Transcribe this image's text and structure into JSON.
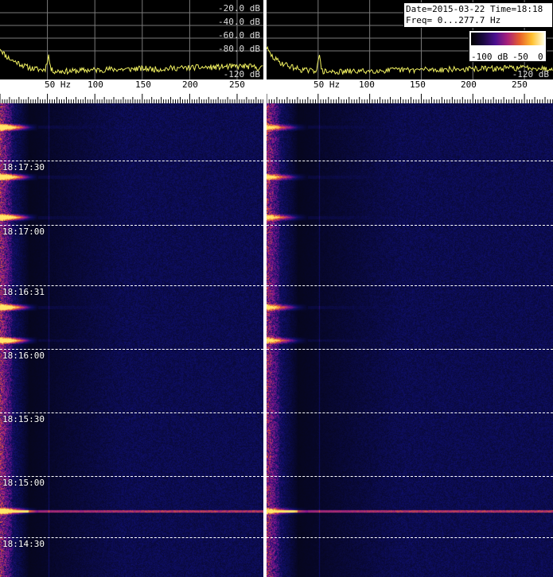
{
  "info_box": {
    "date_line": "Date=2015-03-22 Time=18:18",
    "freq_line": "Freq= 0...277.7 Hz"
  },
  "colorbar": {
    "ticks": [
      "-100 dB",
      "-50",
      "0"
    ],
    "stops": [
      "#000000",
      "#1a0840",
      "#4a0f8f",
      "#a8207a",
      "#e8602a",
      "#ffc030",
      "#ffffe0"
    ]
  },
  "colors": {
    "spectrum_line": "#f0f060",
    "grid": "#7a7a7a",
    "scale_bg": "#ffffff",
    "waterfall_bg": "#0a0c3a"
  },
  "chart_data": [
    {
      "type": "line",
      "name": "spectrum-left",
      "title": "",
      "xlabel": "Hz",
      "ylabel": "",
      "xlim": [
        0,
        277.7
      ],
      "ylim": [
        -125,
        0
      ],
      "y_ticks": [
        -20,
        -40,
        -60,
        -80,
        -120
      ],
      "y_tick_labels": [
        "-20.0 dB",
        "-40.0 dB",
        "-60.0 dB",
        "-80.0 dB",
        "-120 dB"
      ],
      "x_ticks": [
        50,
        100,
        150,
        200,
        250
      ],
      "x_tick_labels": [
        "50 Hz",
        "100",
        "150",
        "200",
        "250"
      ],
      "grid": true,
      "series": [
        {
          "x": [
            0,
            3,
            6,
            10,
            14,
            18,
            22,
            26,
            30,
            35,
            40,
            45,
            48,
            50,
            51,
            52,
            54,
            58,
            65,
            75,
            85,
            95,
            105,
            115,
            125,
            135,
            145,
            155,
            165,
            175,
            185,
            195,
            205,
            215,
            225,
            235,
            245,
            255,
            265,
            275
          ],
          "values": [
            -75,
            -82,
            -88,
            -92,
            -96,
            -98,
            -101,
            -104,
            -106,
            -108,
            -109,
            -110,
            -108,
            -94,
            -84,
            -96,
            -110,
            -112,
            -112,
            -112,
            -111,
            -110,
            -110,
            -109,
            -109,
            -109,
            -108,
            -108,
            -109,
            -108,
            -107,
            -107,
            -106,
            -106,
            -106,
            -105,
            -105,
            -104,
            -105,
            -107
          ]
        }
      ]
    },
    {
      "type": "line",
      "name": "spectrum-right",
      "title": "",
      "xlabel": "Hz",
      "ylabel": "",
      "xlim": [
        0,
        277.7
      ],
      "ylim": [
        -125,
        0
      ],
      "y_ticks": [
        -120
      ],
      "y_tick_labels": [
        "-120 dB"
      ],
      "x_ticks": [
        50,
        100,
        150,
        200,
        250
      ],
      "x_tick_labels": [
        "50 Hz",
        "100",
        "150",
        "200",
        "250"
      ],
      "grid": true,
      "series": [
        {
          "x": [
            0,
            3,
            6,
            10,
            14,
            18,
            22,
            26,
            30,
            35,
            40,
            45,
            48,
            50,
            51,
            52,
            54,
            58,
            65,
            75,
            85,
            95,
            105,
            115,
            125,
            135,
            145,
            155,
            165,
            175,
            185,
            195,
            205,
            215,
            225,
            235,
            245,
            255,
            265,
            275
          ],
          "values": [
            -75,
            -84,
            -90,
            -95,
            -99,
            -101,
            -104,
            -106,
            -108,
            -110,
            -111,
            -112,
            -110,
            -96,
            -86,
            -98,
            -112,
            -113,
            -113,
            -113,
            -112,
            -112,
            -111,
            -111,
            -110,
            -110,
            -110,
            -109,
            -110,
            -109,
            -109,
            -109,
            -108,
            -108,
            -108,
            -107,
            -107,
            -106,
            -107,
            -109
          ]
        }
      ]
    },
    {
      "type": "heatmap",
      "name": "waterfall",
      "title": "",
      "xlabel": "Hz",
      "ylabel": "Time",
      "xlim": [
        0,
        277.7
      ],
      "time_range": [
        "18:18",
        "18:14:30"
      ],
      "time_labels": [
        "18:17:30",
        "18:17:00",
        "18:16:31",
        "18:16:00",
        "18:15:30",
        "18:15:00",
        "18:14:30"
      ],
      "time_label_fraction": [
        0.135,
        0.285,
        0.425,
        0.575,
        0.725,
        0.87,
        1.0
      ],
      "intensity_scale_db": [
        -100,
        0
      ],
      "features": {
        "tonal_line_hz": 51,
        "burst_fractions": [
          0.05,
          0.155,
          0.24,
          0.43,
          0.5,
          0.86
        ],
        "broadband_line_fraction": 0.86
      }
    }
  ]
}
